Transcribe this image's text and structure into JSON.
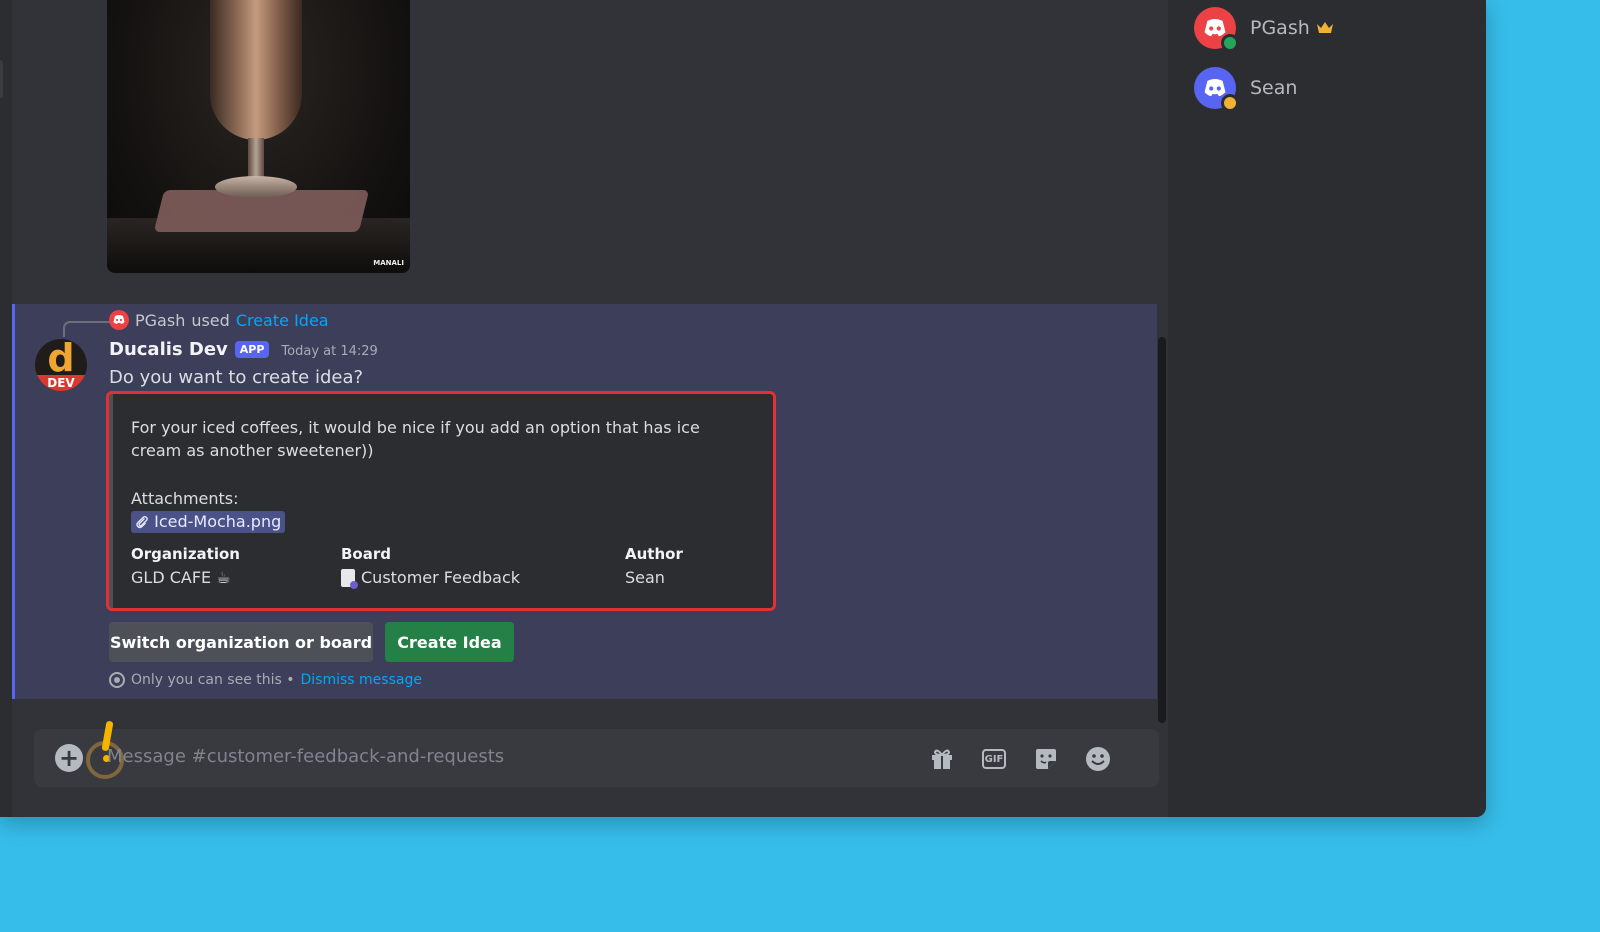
{
  "channel": {
    "composer_placeholder": "Message #customer-feedback-and-requests"
  },
  "attachment_image": {
    "watermark": "MANALI"
  },
  "message": {
    "reply": {
      "user": "PGash",
      "verb": "used",
      "command": "Create Idea"
    },
    "author": "Ducalis Dev",
    "badge": "APP",
    "timestamp": "Today at 14:29",
    "avatar_letter": "d",
    "avatar_tag": "DEV",
    "text": "Do you want to create idea?",
    "embed": {
      "description": "For your iced coffees, it would be nice if you add an option that has ice cream as another sweetener))",
      "attachments_label": "Attachments:",
      "attachment_file": "Iced-Mocha.png",
      "fields": [
        {
          "name": "Organization",
          "value": "GLD CAFE ☕"
        },
        {
          "name": "Board",
          "value": "Customer Feedback"
        },
        {
          "name": "Author",
          "value": "Sean"
        }
      ]
    },
    "buttons": {
      "switch": "Switch organization or board",
      "create": "Create Idea"
    },
    "ephemeral": {
      "note": "Only you can see this •",
      "dismiss": "Dismiss message"
    }
  },
  "members": [
    {
      "name": "PGash",
      "status": "online",
      "owner": true,
      "avatar_color": "#ed4245",
      "status_color": "#23a55a"
    },
    {
      "name": "Sean",
      "status": "idle",
      "owner": false,
      "avatar_color": "#5865f2",
      "status_color": "#f0b232"
    }
  ],
  "icons": {
    "composer": [
      "plus-icon",
      "gift-icon",
      "gif-icon",
      "sticker-icon",
      "emoji-icon"
    ],
    "owner": "crown-icon"
  },
  "colors": {
    "accent": "#5865f2",
    "success_button": "#248046",
    "link": "#00a8fc",
    "highlight_outline": "#e0313a",
    "desktop_background": "#36bde9"
  }
}
